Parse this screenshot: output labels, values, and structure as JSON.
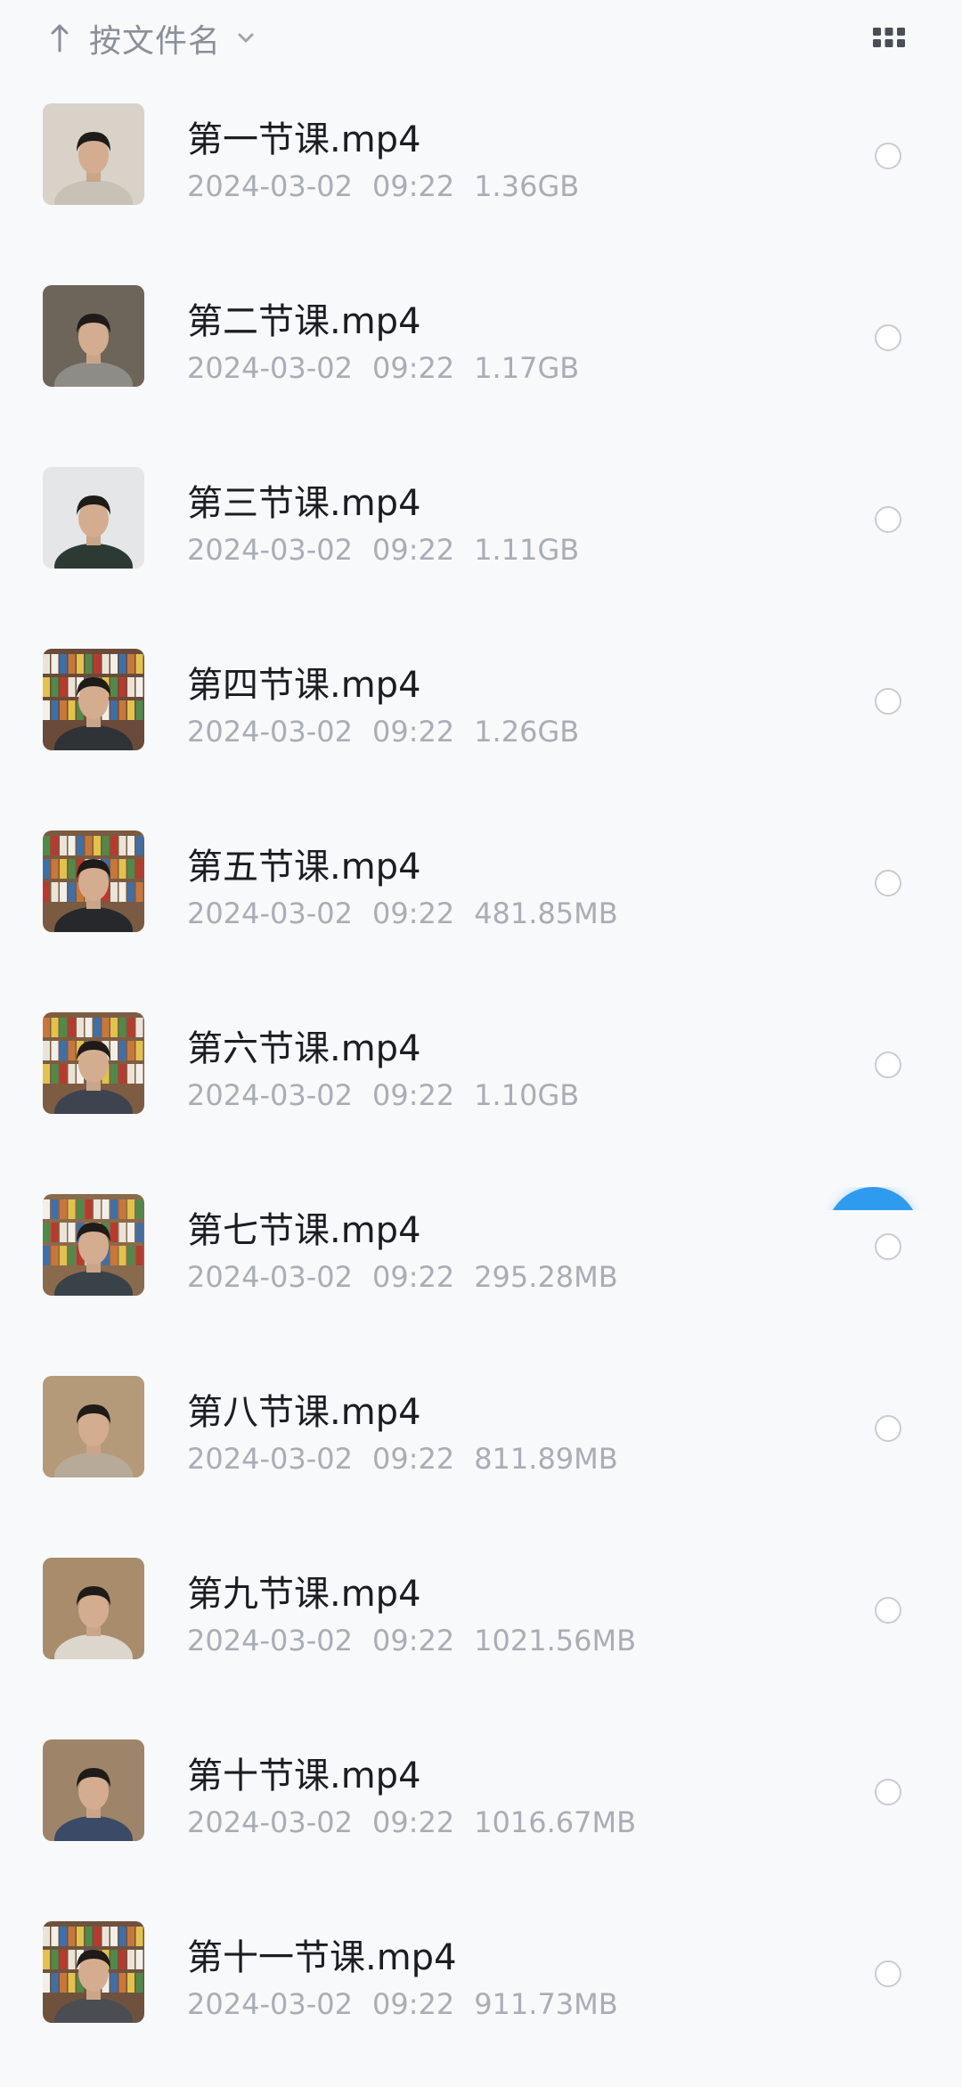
{
  "sort": {
    "label": "按文件名",
    "arrow_icon": "arrow-up-icon",
    "chevron_icon": "chevron-down-icon"
  },
  "view_toggle": {
    "icon": "grid-view-icon"
  },
  "accent_color": "#2f9bef",
  "files": [
    {
      "name": "第一节课.mp4",
      "date": "2024-03-02",
      "time": "09:22",
      "size": "1.36GB"
    },
    {
      "name": "第二节课.mp4",
      "date": "2024-03-02",
      "time": "09:22",
      "size": "1.17GB"
    },
    {
      "name": "第三节课.mp4",
      "date": "2024-03-02",
      "time": "09:22",
      "size": "1.11GB"
    },
    {
      "name": "第四节课.mp4",
      "date": "2024-03-02",
      "time": "09:22",
      "size": "1.26GB"
    },
    {
      "name": "第五节课.mp4",
      "date": "2024-03-02",
      "time": "09:22",
      "size": "481.85MB"
    },
    {
      "name": "第六节课.mp4",
      "date": "2024-03-02",
      "time": "09:22",
      "size": "1.10GB"
    },
    {
      "name": "第七节课.mp4",
      "date": "2024-03-02",
      "time": "09:22",
      "size": "295.28MB"
    },
    {
      "name": "第八节课.mp4",
      "date": "2024-03-02",
      "time": "09:22",
      "size": "811.89MB"
    },
    {
      "name": "第九节课.mp4",
      "date": "2024-03-02",
      "time": "09:22",
      "size": "1021.56MB"
    },
    {
      "name": "第十节课.mp4",
      "date": "2024-03-02",
      "time": "09:22",
      "size": "1016.67MB"
    },
    {
      "name": "第十一节课.mp4",
      "date": "2024-03-02",
      "time": "09:22",
      "size": "911.73MB"
    }
  ]
}
